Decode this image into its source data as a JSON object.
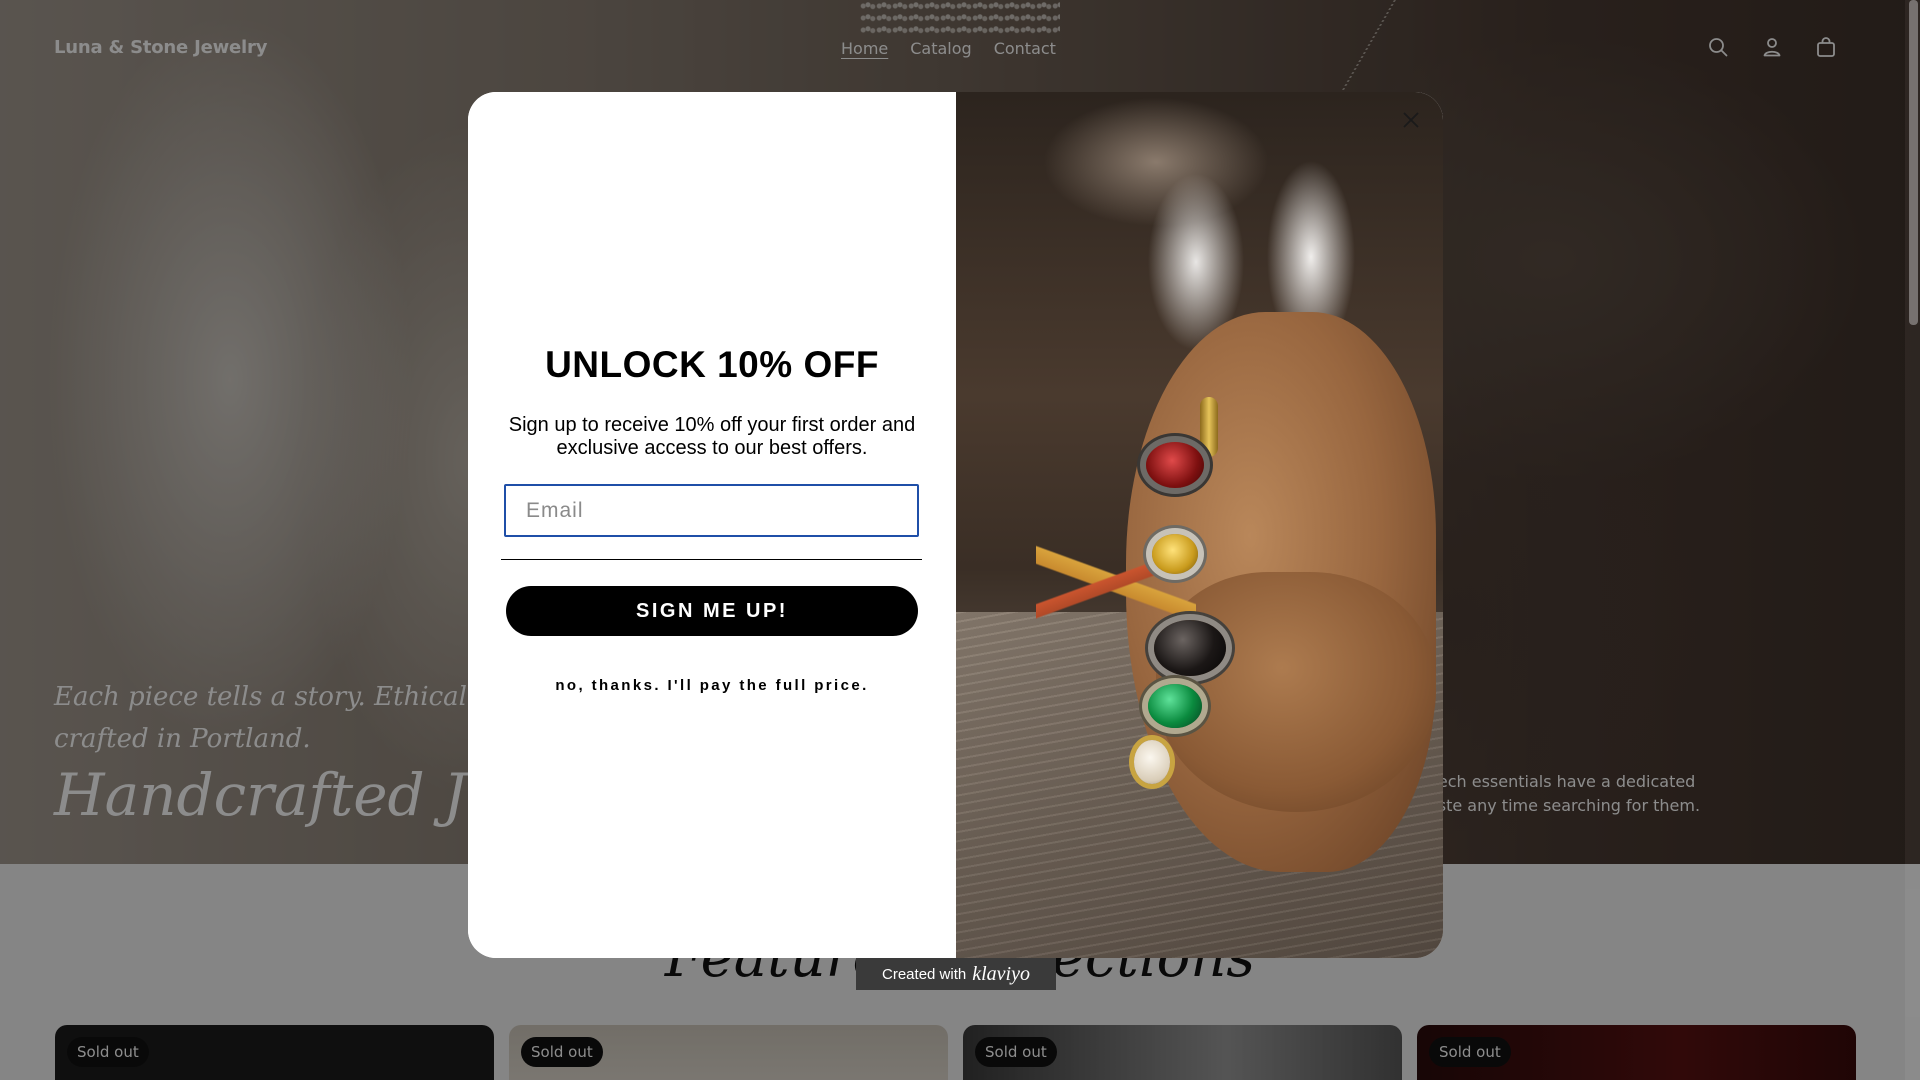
{
  "store": {
    "logo": "Luna & Stone Jewelry",
    "nav": [
      "Home",
      "Catalog",
      "Contact"
    ],
    "header_icons": [
      "search-icon",
      "account-icon",
      "cart-icon"
    ]
  },
  "hero": {
    "subtitle_line1": "Each piece tells a story. Ethically sou",
    "subtitle_line2": "crafted in Portland.",
    "title": "Handcrafted Jewel",
    "right_line1": "our tech essentials have a dedicated",
    "right_line2": "o waste any time searching for them."
  },
  "collections": {
    "title": "Featured Collections",
    "badges": [
      "Sold out",
      "Sold out",
      "Sold out",
      "Sold out"
    ]
  },
  "popup": {
    "headline": "UNLOCK 10% OFF",
    "subtext": "Sign up to receive 10% off your first order and exclusive access to our best offers.",
    "email_placeholder": "Email",
    "email_value": "",
    "submit_label": "SIGN ME UP!",
    "decline_label": "no, thanks. I'll pay the full price.",
    "close_icon": "close-icon"
  },
  "footer_badge": {
    "prefix": "Created with",
    "brand": "klaviyo"
  },
  "colors": {
    "input_border": "#1f4fa8",
    "button_bg": "#000000",
    "overlay": "rgba(0,0,0,0.45)"
  }
}
